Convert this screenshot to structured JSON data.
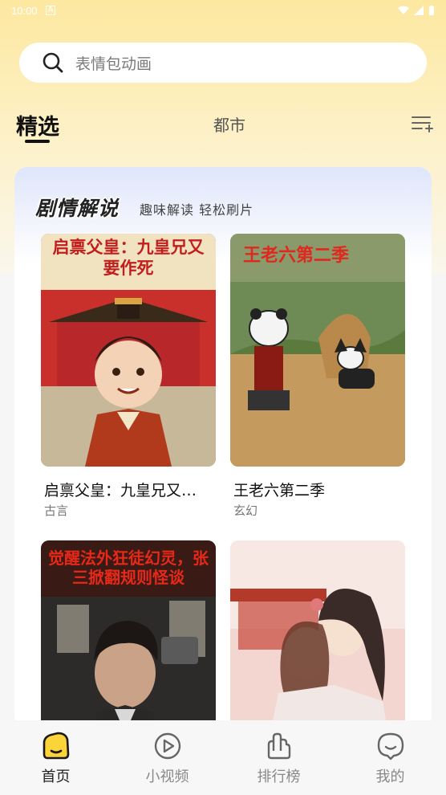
{
  "status_bar": {
    "time": "10:00",
    "sim_label": "A"
  },
  "search": {
    "placeholder": "表情包动画"
  },
  "tabs": [
    {
      "label": "精选",
      "active": true
    },
    {
      "label": "都市",
      "active": false
    }
  ],
  "section": {
    "title": "剧情解说",
    "subtitle": "趣味解读 轻松刷片",
    "items": [
      {
        "title": "启禀父皇：九皇兄又…",
        "tag": "古言",
        "cover_text": "启禀父皇：九皇兄又要作死"
      },
      {
        "title": "王老六第二季",
        "tag": "玄幻",
        "cover_text": "王老六第二季"
      },
      {
        "title": "",
        "tag": "",
        "cover_text": "觉醒法外狂徒幻灵，张三掀翻规则怪谈"
      },
      {
        "title": "",
        "tag": "",
        "cover_text": ""
      }
    ]
  },
  "bottom_nav": [
    {
      "label": "首页",
      "icon": "home-face-icon",
      "active": true
    },
    {
      "label": "小视频",
      "icon": "play-circle-icon",
      "active": false
    },
    {
      "label": "排行榜",
      "icon": "ranking-hand-icon",
      "active": false
    },
    {
      "label": "我的",
      "icon": "profile-face-icon",
      "active": false
    }
  ],
  "colors": {
    "accent": "#fdd33a",
    "header_bg": "#fde8a0"
  }
}
